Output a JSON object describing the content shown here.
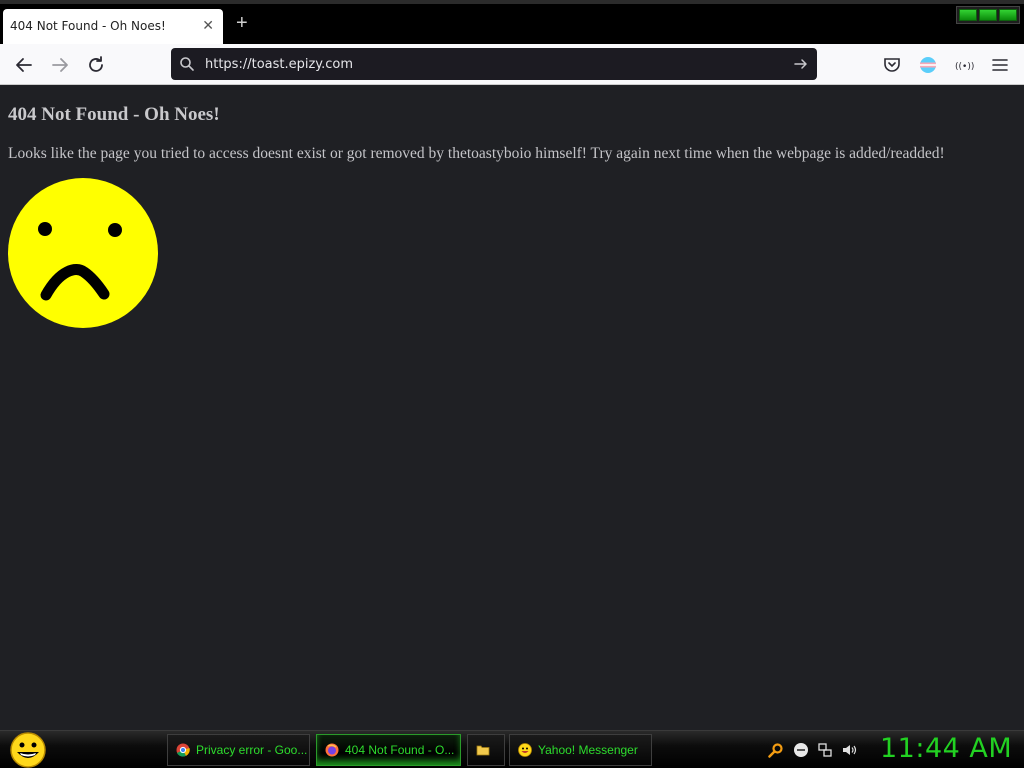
{
  "browser": {
    "tab": {
      "title": "404 Not Found - Oh Noes!",
      "close": "✕"
    },
    "new_tab": "+",
    "url": "https://toast.epizy.com"
  },
  "page": {
    "heading": "404 Not Found - Oh Noes!",
    "message": "Looks like the page you tried to access doesnt exist or got removed by thetoastyboio himself! Try again next time when the webpage is added/readded!"
  },
  "taskbar": {
    "tasks": [
      {
        "label": "Privacy error - Goo...",
        "icon": "chrome-icon"
      },
      {
        "label": "404 Not Found - O...",
        "icon": "firefox-icon",
        "active": true
      },
      {
        "label": "",
        "icon": "folder-icon"
      },
      {
        "label": "Yahoo! Messenger",
        "icon": "yahoo-messenger-icon"
      }
    ],
    "clock": "11:44 AM"
  },
  "colors": {
    "page_bg": "#1f2024",
    "taskbar_text": "#2ddc2d",
    "clock": "#22d122",
    "face": "#ffff00"
  }
}
